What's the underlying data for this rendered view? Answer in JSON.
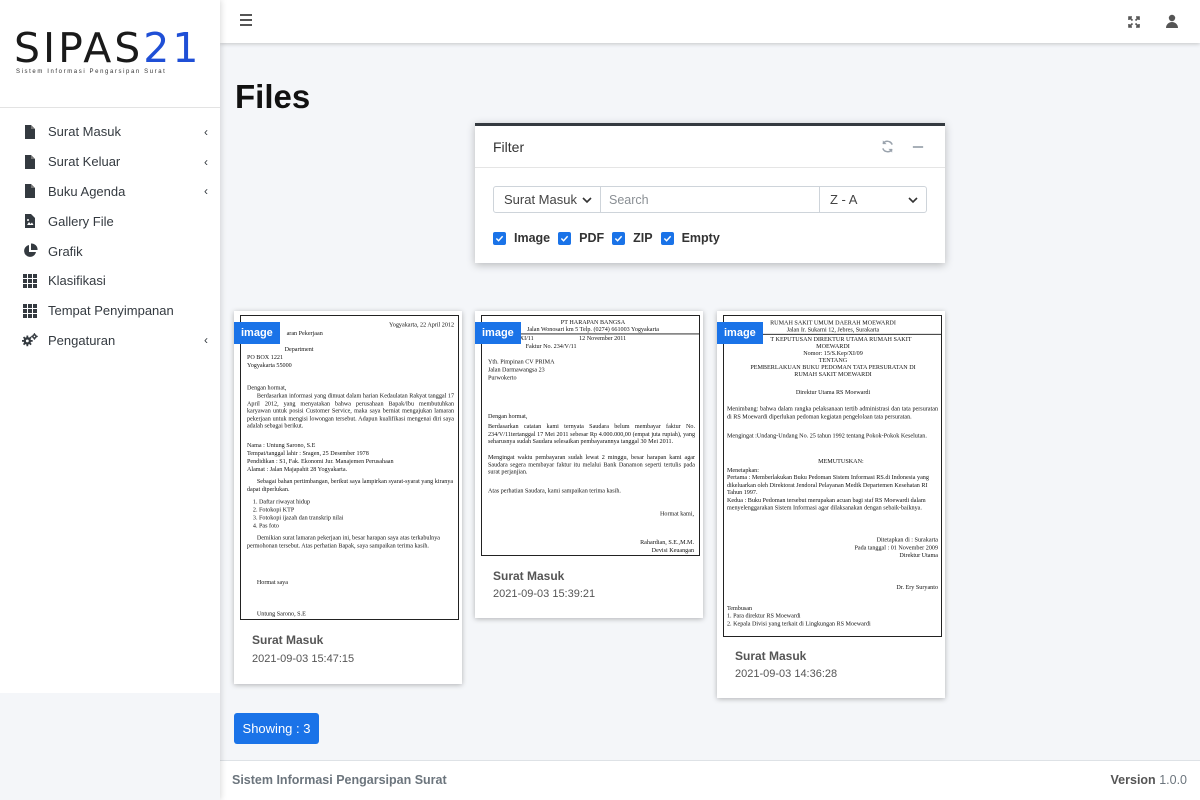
{
  "brand": {
    "logo_text": "SIPAS",
    "logo_number": "21",
    "tagline": "Sistem Informasi Pengarsipan Surat"
  },
  "sidebar": {
    "items": [
      {
        "label": "Surat Masuk",
        "icon": "file-icon",
        "has_caret": true
      },
      {
        "label": "Surat Keluar",
        "icon": "file-icon",
        "has_caret": true
      },
      {
        "label": "Buku Agenda",
        "icon": "file-icon",
        "has_caret": true
      },
      {
        "label": "Gallery File",
        "icon": "file-image-icon",
        "has_caret": false
      },
      {
        "label": "Grafik",
        "icon": "pie-chart-icon",
        "has_caret": false
      },
      {
        "label": "Klasifikasi",
        "icon": "grid-icon",
        "has_caret": false
      },
      {
        "label": "Tempat Penyimpanan",
        "icon": "grid-icon",
        "has_caret": false
      },
      {
        "label": "Pengaturan",
        "icon": "gears-icon",
        "has_caret": true
      }
    ]
  },
  "topbar": {
    "menu_icon": "hamburger-icon",
    "expand_icon": "expand-icon",
    "user_icon": "user-icon"
  },
  "page": {
    "title": "Files"
  },
  "filter": {
    "title": "Filter",
    "refresh_icon": "refresh-icon",
    "collapse_icon": "minus-icon",
    "type_select": "Surat Masuk",
    "search_placeholder": "Search",
    "search_value": "",
    "sort_select": "Z - A",
    "checkboxes": [
      {
        "label": "Image",
        "checked": true
      },
      {
        "label": "PDF",
        "checked": true
      },
      {
        "label": "ZIP",
        "checked": true
      },
      {
        "label": "Empty",
        "checked": true
      }
    ]
  },
  "files": [
    {
      "badge": "image",
      "title": "Surat Masuk",
      "date": "2021-09-03 15:47:15"
    },
    {
      "badge": "image",
      "title": "Surat Masuk",
      "date": "2021-09-03 15:39:21"
    },
    {
      "badge": "image",
      "title": "Surat Masuk",
      "date": "2021-09-03 14:36:28"
    }
  ],
  "documents": {
    "doc1": {
      "date_line": "Yogyakarta, 22 April 2012",
      "subject": "aran Pekerjaan",
      "dept": "Department",
      "po_box": "PO BOX 1221",
      "city": "Yogyakarta 55000",
      "greeting": "Dengan hormat,",
      "para1": "Berdasarkan informasi yang dimuat dalam harian Kedaulatan Rakyat tanggal 17 April 2012, yang menyatakan bahwa perusahaan Bapak/Ibu membutuhkan karyawan untuk posisi Customer Service, maka saya berniat mengajukan lamaran pekerjaan untuk mengisi lowongan tersebut. Adapun kualifikasi mengenai diri saya adalah sebagai berikut.",
      "nama": "Nama                : Untung Sarono, S.E",
      "ttl": "Tempat/tanggal lahir  : Sragen, 25 Desember 1978",
      "pend": "Pendidikan           : S1, Fak. Ekonomi Jur. Manajemen Perusahaan",
      "alamat": "Alamat               : Jalan Majapahit 28 Yogyakarta.",
      "para2": "Sebagai bahan pertimbangan, berikut saya lampirkan syarat-syarat yang kiranya dapat diperlukan.",
      "list1": "1.   Daftar riwayat hidup",
      "list2": "2.   Fotokopi KTP",
      "list3": "3.   Fotokopi ijazah dan transkrip nilai",
      "list4": "4.   Pas foto",
      "para3": "Demikian surat lamaran pekerjaan ini, besar harapan saya atas terkabulnya permohonan tersebut. Atas perhatian Bapak, saya sampaikan terima kasih.",
      "closing": "Hormat saya",
      "signer": "Untung Sarono, S.E"
    },
    "doc2": {
      "company": "PT HARAPAN BANGSA",
      "address": "Jalan Wonosari km 5 Telp. (0274) 661003 Yogyakarta",
      "ref": "XI/11",
      "date": "12 November 2011",
      "subject": "Faktur No. 234/V/11",
      "to1": "Yth. Pimpinan CV PRIMA",
      "to2": "Jalan Darmawangsa 23",
      "to3": "Purwokerto",
      "greeting": "Dengan hormat,",
      "para1": "Berdasarkan catatan kami ternyata Saudara belum membayar faktur No. 234/V/11tertanggal 17 Mei 2011 sebesar Rp 4.000.000,00 (empat juta rupiah), yang seharusnya sudah Saudara selesaikan pembayarannya tanggal 30 Mei 2011.",
      "para2": "Mengingat waktu pembayaran sudah lewat 2 minggu, besar harapan kami agar Saudara segera membayar faktur itu melalui Bank Danamon seperti tertulis pada surat perjanjian.",
      "para3": "Atas perhatian Saudara, kami sampaikan terima kasih.",
      "closing": "Hormat kami,",
      "signer": "Rahardian, S.E.,M.M.",
      "signer_title": "Devisi Keuangan"
    },
    "doc3": {
      "hosp": "RUMAH SAKIT UMUM DAERAH MOEWARDI",
      "addr": "Jalan Ir. Sukarni 12, Jebres, Surakarta",
      "decree1": "T KEPUTUSAN DIREKTUR UTAMA RUMAH SAKIT",
      "decree2": "MOEWARDI",
      "nomor": "Nomor: 15/S.Kep/XI/09",
      "tentang": "TENTANG",
      "about1": "PEMBERLAKUAN BUKU PEDOMAN TATA PERSURATAN DI",
      "about2": "RUMAH SAKIT MOEWARDI",
      "director": "Direktur Utama RS Moewardi",
      "menimbang": "Menimbang: bahwa dalam rangka pelaksanaan tertib administrasi dan tata persuratan di RS Moewardi diperlukan pedoman kegiatan pengelolaan tata persuratan.",
      "mengingat": "Mengingat :Undang-Undang No. 25 tahun 1992 tentang Pokok-Pokok Keselutan.",
      "memutuskan": "MEMUTUSKAN:",
      "menetapkan": "Menetapkan:",
      "pertama": "Pertama   : Memberlakukan Buku Pedoman Sistem Informasi RS.di Indonesia yang dikeluarkan oleh Direktorat Jendoral Pelayanan Medik Departemen Kesehatan RI Tahun 1997.",
      "kedua": "Kedua      : Buku Pedoman tersebut merupakan acuan bagi staf RS Moewardi dalam menyelenggarakan Sistem Informasi agar dilaksanakan dengan sebaik-baiknya.",
      "ditetapkan": "Ditetapkan di : Surakarta",
      "padatgl": "Pada tanggal : 01 November 2009",
      "dirut": "Direktur Utama",
      "sign": "Dr. Ery Suryanto",
      "tembusan": "Tembusan",
      "t1": "1.  Para direktur RS Moewardi",
      "t2": "2.  Kepala Divisi yang terkait di Lingkungan RS Moewardi"
    }
  },
  "showing": "Showing : 3",
  "footer": {
    "left": "Sistem Informasi Pengarsipan Surat",
    "version_label": "Version",
    "version_value": "1.0.0"
  },
  "colors": {
    "accent": "#1a73e8",
    "sidebar_bg": "#ffffff",
    "content_bg": "#f4f6f9",
    "logo_number": "#1f4fd6"
  }
}
